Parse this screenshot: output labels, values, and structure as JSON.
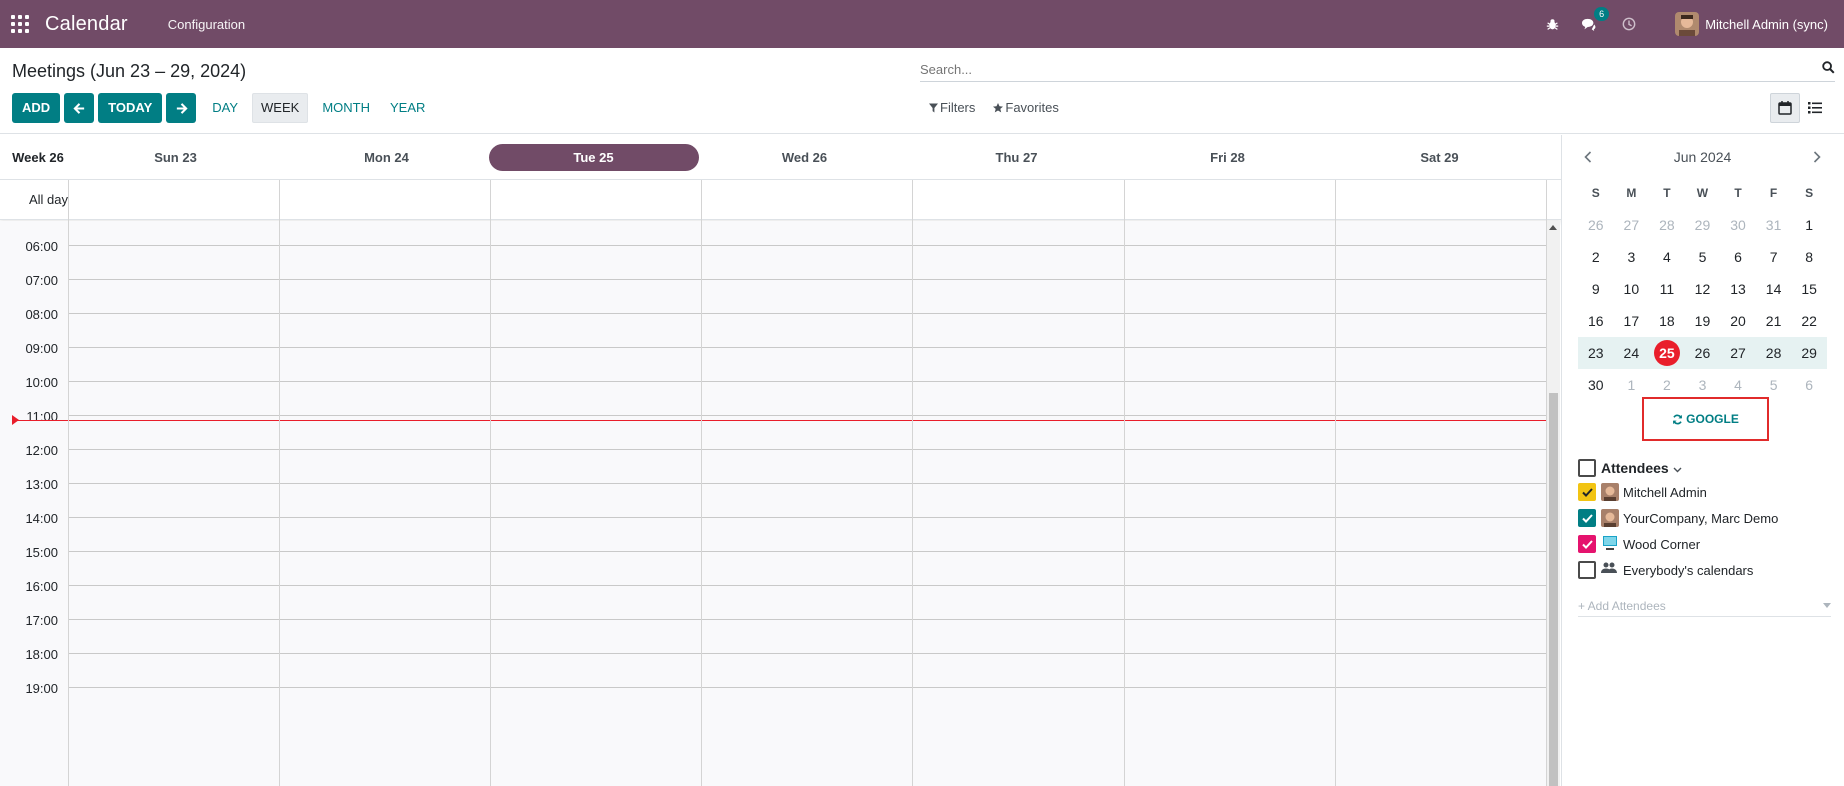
{
  "navbar": {
    "app_title": "Calendar",
    "menu": [
      "Configuration"
    ],
    "messages_count": "6",
    "user_name": "Mitchell Admin (sync)",
    "color": "#714b67"
  },
  "control_panel": {
    "title": "Meetings (Jun 23 – 29, 2024)",
    "add_label": "ADD",
    "today_label": "TODAY",
    "scales": [
      "DAY",
      "WEEK",
      "MONTH",
      "YEAR"
    ],
    "active_scale": "WEEK",
    "search_placeholder": "Search...",
    "filters_label": "Filters",
    "favorites_label": "Favorites"
  },
  "week": {
    "label": "Week 26",
    "days": [
      "Sun 23",
      "Mon 24",
      "Tue 25",
      "Wed 26",
      "Thu 27",
      "Fri 28",
      "Sat 29"
    ],
    "today": "Tue 25",
    "all_day_label": "All day",
    "hours": [
      "06:00",
      "07:00",
      "08:00",
      "09:00",
      "10:00",
      "11:00",
      "12:00",
      "13:00",
      "14:00",
      "15:00",
      "16:00",
      "17:00",
      "18:00",
      "19:00"
    ]
  },
  "mini_calendar": {
    "title": "Jun 2024",
    "weekdays": [
      "S",
      "M",
      "T",
      "W",
      "T",
      "F",
      "S"
    ],
    "weeks": [
      [
        "26",
        "27",
        "28",
        "29",
        "30",
        "31",
        "1"
      ],
      [
        "2",
        "3",
        "4",
        "5",
        "6",
        "7",
        "8"
      ],
      [
        "9",
        "10",
        "11",
        "12",
        "13",
        "14",
        "15"
      ],
      [
        "16",
        "17",
        "18",
        "19",
        "20",
        "21",
        "22"
      ],
      [
        "23",
        "24",
        "25",
        "26",
        "27",
        "28",
        "29"
      ],
      [
        "30",
        "1",
        "2",
        "3",
        "4",
        "5",
        "6"
      ]
    ],
    "today": "25",
    "accent": "#e91e2b"
  },
  "sync_button": "GOOGLE",
  "attendees": {
    "header": "Attendees",
    "items": [
      {
        "name": "Mitchell Admin",
        "color": "#f2c413"
      },
      {
        "name": "YourCompany, Marc Demo",
        "color": "#017e84"
      },
      {
        "name": "Wood Corner",
        "color": "#e5136e"
      },
      {
        "name": "Everybody's calendars",
        "color": ""
      }
    ],
    "add_placeholder": "+ Add Attendees"
  }
}
